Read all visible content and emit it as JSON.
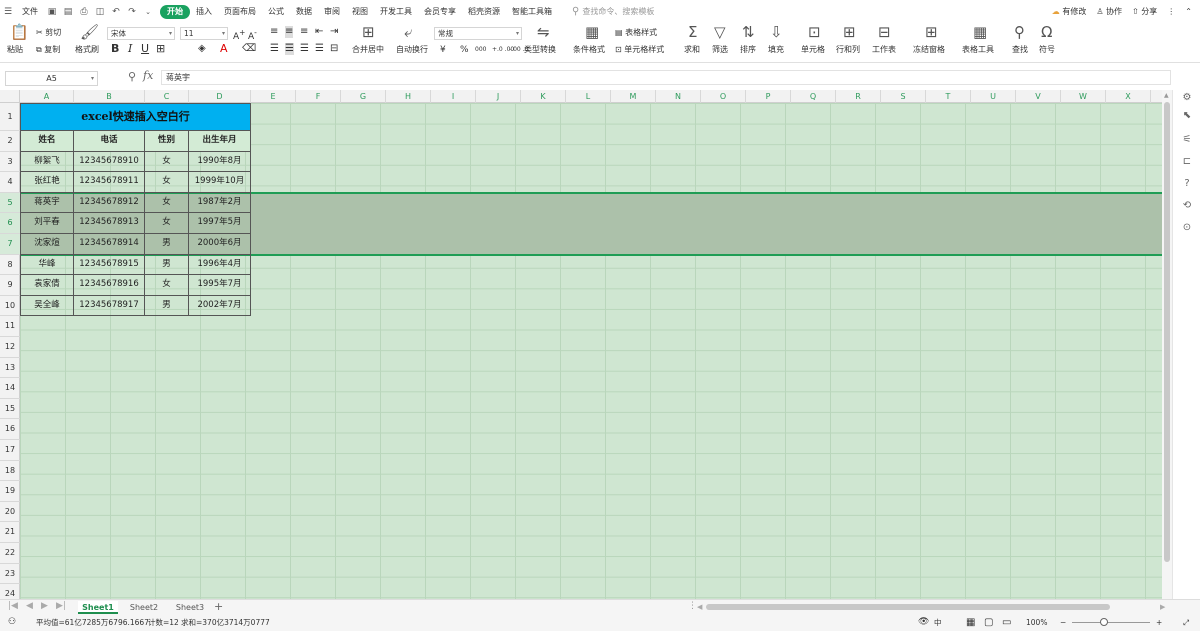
{
  "menubar": {
    "file": "文件",
    "tabs": [
      "开始",
      "插入",
      "页面布局",
      "公式",
      "数据",
      "审阅",
      "视图",
      "开发工具",
      "会员专享",
      "稻壳资源",
      "智能工具箱"
    ],
    "active_tab": "开始",
    "search_placeholder": "查找命令、搜索模板",
    "right": {
      "modify": "有修改",
      "collab": "协作",
      "share": "分享"
    }
  },
  "ribbon": {
    "paste": "粘贴",
    "cut": "剪切",
    "copy": "复制",
    "format_painter": "格式刷",
    "font_name": "宋体",
    "font_size": "11",
    "merge_center": "合并居中",
    "wrap_text": "自动换行",
    "number_format": "常规",
    "type_convert": "类型转换",
    "conditional_format": "条件格式",
    "table_style": "表格样式",
    "cell_style": "单元格样式",
    "sum": "求和",
    "filter": "筛选",
    "sort": "排序",
    "fill": "填充",
    "cell": "单元格",
    "row_col": "行和列",
    "worksheet": "工作表",
    "freeze": "冻结窗格",
    "table_tools": "表格工具",
    "find": "查找",
    "symbol": "符号",
    "currency": "¥",
    "percent": "%",
    "thousands": "000",
    "inc_decimal": "+.0 .00",
    "dec_decimal": "-.00 .0"
  },
  "formula_bar": {
    "name_box": "A5",
    "content": "蒋英宇"
  },
  "columns": [
    "A",
    "B",
    "C",
    "D",
    "E",
    "F",
    "G",
    "H",
    "I",
    "J",
    "K",
    "L",
    "M",
    "N",
    "O",
    "P",
    "Q",
    "R",
    "S",
    "T",
    "U",
    "V",
    "W",
    "X"
  ],
  "rows": [
    "1",
    "2",
    "3",
    "4",
    "5",
    "6",
    "7",
    "8",
    "9",
    "10",
    "11",
    "12",
    "13",
    "14",
    "15",
    "16",
    "17",
    "18",
    "19",
    "20",
    "21",
    "22",
    "23",
    "24"
  ],
  "selected_rows": [
    "5",
    "6",
    "7"
  ],
  "table": {
    "title": "excel快速插入空白行",
    "headers": [
      "姓名",
      "电话",
      "性别",
      "出生年月"
    ],
    "data": [
      [
        "柳絮飞",
        "12345678910",
        "女",
        "1990年8月"
      ],
      [
        "张红艳",
        "12345678911",
        "女",
        "1999年10月"
      ],
      [
        "蒋英宇",
        "12345678912",
        "女",
        "1987年2月"
      ],
      [
        "刘平春",
        "12345678913",
        "女",
        "1997年5月"
      ],
      [
        "沈家煊",
        "12345678914",
        "男",
        "2000年6月"
      ],
      [
        "华峰",
        "12345678915",
        "男",
        "1996年4月"
      ],
      [
        "袁家倩",
        "12345678916",
        "女",
        "1995年7月"
      ],
      [
        "吴全峰",
        "12345678917",
        "男",
        "2002年7月"
      ]
    ]
  },
  "sheets": [
    "Sheet1",
    "Sheet2",
    "Sheet3"
  ],
  "active_sheet": "Sheet1",
  "status": {
    "average": "平均值=61亿7285万6796.1667",
    "count": "计数=12",
    "sum": "求和=370亿3714万0777",
    "zoom": "100%"
  },
  "colors": {
    "accent": "#1aa260",
    "title_fill": "#00b0f0",
    "eye_protection": "#cfe6d1",
    "selection": "#acc1aa"
  }
}
